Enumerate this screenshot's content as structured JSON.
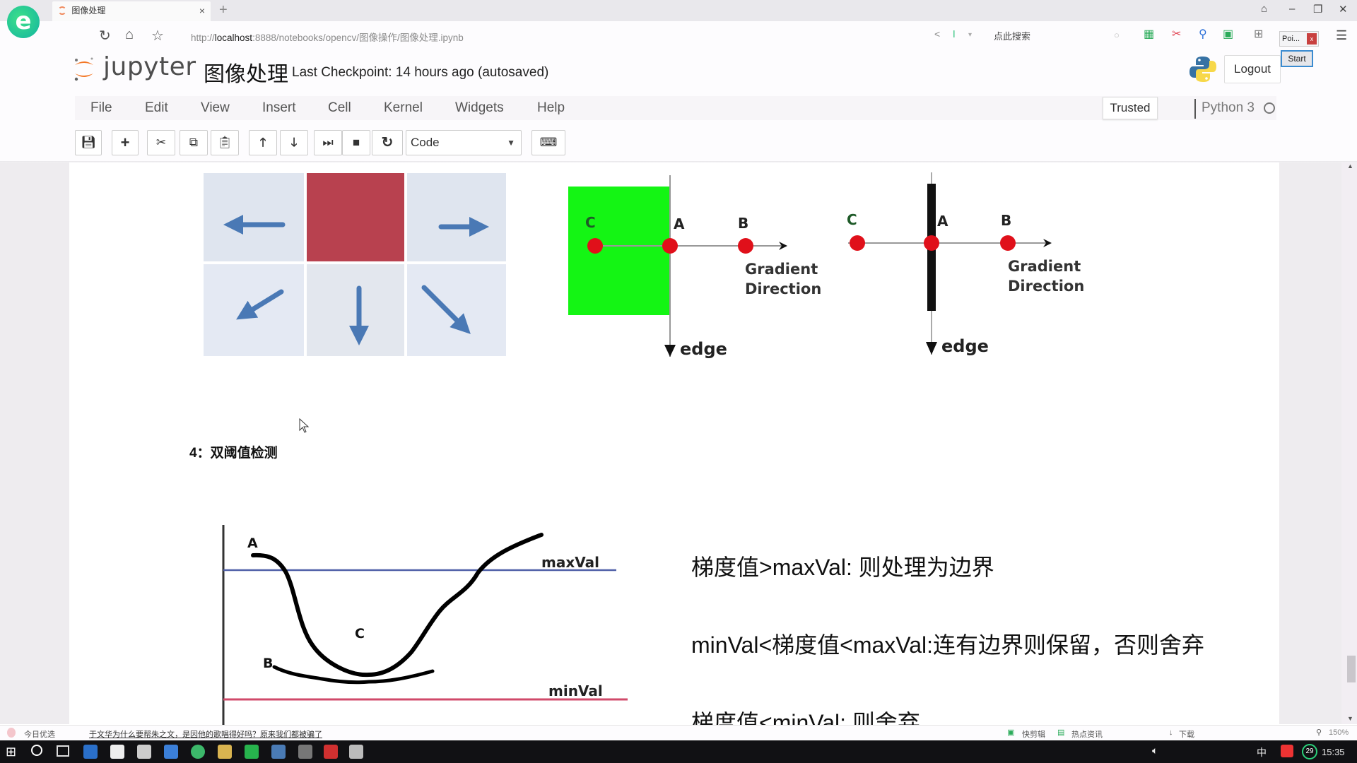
{
  "browser": {
    "logo": "e",
    "tab_title": "图像处理",
    "new_tab": "+",
    "url_prefix": "http://",
    "url_host": "localhost",
    "url_rest": ":8888/notebooks/opencv/图像操作/图像处理.ipynb",
    "search_hint": "点此搜索",
    "popup_label": "Poi...",
    "popup_start": "Start"
  },
  "jupyter": {
    "logo_text": "jupyter",
    "notebook_title": "图像处理",
    "checkpoint": "Last Checkpoint: 14 hours ago (autosaved)",
    "logout": "Logout",
    "menu": [
      "File",
      "Edit",
      "View",
      "Insert",
      "Cell",
      "Kernel",
      "Widgets",
      "Help"
    ],
    "trusted": "Trusted",
    "kernel": "Python 3",
    "cell_type": "Code",
    "toolbar": [
      "save",
      "insert-cell-below",
      "cut",
      "copy",
      "paste",
      "move-up",
      "move-down",
      "run",
      "interrupt",
      "restart",
      "command-palette"
    ]
  },
  "figure_directions": {
    "cells": [
      "left-arrow",
      "center-pixel",
      "right-arrow",
      "down-left-arrow",
      "down-arrow",
      "down-right-arrow"
    ],
    "center_color": "#b8414f",
    "arrow_color": "#4a79b5"
  },
  "figure_gradient": {
    "left_panel": {
      "labels": [
        "C",
        "A",
        "B"
      ],
      "direction_label_1": "Gradient",
      "direction_label_2": "Direction",
      "edge_label": "edge",
      "region_color": "#14f514"
    },
    "right_panel": {
      "labels": [
        "C",
        "A",
        "B"
      ],
      "direction_label_1": "Gradient",
      "direction_label_2": "Direction",
      "edge_label": "edge"
    }
  },
  "section": {
    "heading": "4：双阈值检测"
  },
  "figure_threshold": {
    "labels": {
      "A": "A",
      "B": "B",
      "C": "C",
      "max": "maxVal",
      "min": "minVal"
    },
    "max_color": "#5060a8",
    "min_color": "#d04a6a"
  },
  "rules": [
    "梯度值>maxVal: 则处理为边界",
    "minVal<梯度值<maxVal:连有边界则保留，否则舍弃",
    "梯度值<minVal: 则舍弃"
  ],
  "statusbar": {
    "left_label": "今日优选",
    "news": "于文华为什么要帮朱之文，是因他的歌唱得好吗？原来我们都被骗了",
    "right_items": [
      "快剪辑",
      "热点资讯",
      "下载"
    ],
    "zoom": "150%"
  },
  "taskbar": {
    "time": "15:35",
    "ime": "中",
    "badge": "29"
  }
}
